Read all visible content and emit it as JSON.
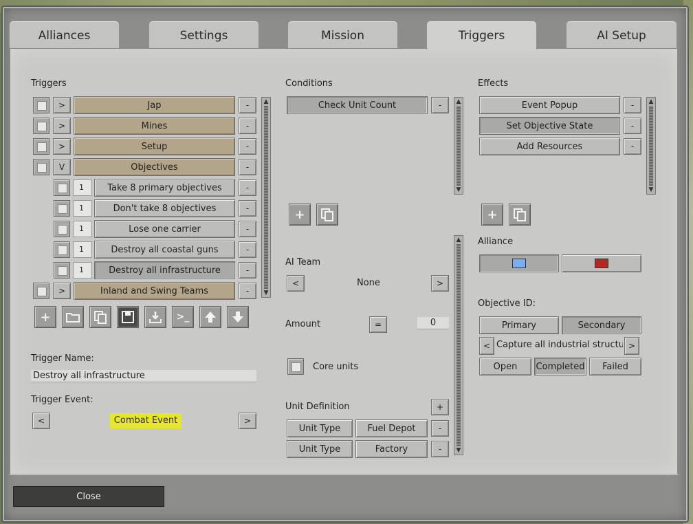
{
  "tabs": [
    {
      "label": "Alliances"
    },
    {
      "label": "Settings"
    },
    {
      "label": "Mission"
    },
    {
      "label": "Triggers"
    },
    {
      "label": "AI Setup"
    }
  ],
  "triggers": {
    "heading": "Triggers",
    "items": [
      {
        "expander": ">",
        "label": "Jap",
        "num": ""
      },
      {
        "expander": ">",
        "label": "Mines",
        "num": ""
      },
      {
        "expander": ">",
        "label": "Setup",
        "num": ""
      },
      {
        "expander": "V",
        "label": "Objectives",
        "num": ""
      },
      {
        "expander": "",
        "label": "Take 8 primary objectives",
        "num": "1"
      },
      {
        "expander": "",
        "label": "Don't take 8 objectives",
        "num": "1"
      },
      {
        "expander": "",
        "label": "Lose one carrier",
        "num": "1"
      },
      {
        "expander": "",
        "label": "Destroy all coastal guns",
        "num": "1"
      },
      {
        "expander": "",
        "label": "Destroy all infrastructure",
        "num": "1"
      },
      {
        "expander": ">",
        "label": "Inland and Swing Teams",
        "num": ""
      }
    ],
    "remove_label": "-",
    "toolbar": [
      "add-icon",
      "folder-icon",
      "copy-icon",
      "save-icon",
      "import-icon",
      "console-icon",
      "arrow-up-icon",
      "arrow-down-icon"
    ],
    "name_label": "Trigger Name:",
    "name_value": "Destroy all infrastructure",
    "event_label": "Trigger Event:",
    "event_value": "Combat Event",
    "prev": "<",
    "next": ">"
  },
  "conditions": {
    "heading": "Conditions",
    "items": [
      {
        "label": "Check Unit Count"
      }
    ],
    "remove_label": "-",
    "ai_team_label": "AI Team",
    "ai_team_value": "None",
    "prev": "<",
    "next": ">",
    "amount_label": "Amount",
    "amount_op": "=",
    "amount_value": "0",
    "core_units_label": "Core units",
    "unit_def_label": "Unit Definition",
    "add_label": "+",
    "unit_defs": [
      {
        "type": "Unit Type",
        "value": "Fuel Depot"
      },
      {
        "type": "Unit Type",
        "value": "Factory"
      }
    ]
  },
  "effects": {
    "heading": "Effects",
    "items": [
      {
        "label": "Event Popup"
      },
      {
        "label": "Set Objective State"
      },
      {
        "label": "Add Resources"
      }
    ],
    "remove_label": "-",
    "alliance_label": "Alliance",
    "alliance_colors": [
      "#7aaef0",
      "#b02a22"
    ],
    "objective_label": "Objective ID:",
    "primary": "Primary",
    "secondary": "Secondary",
    "objective_value": "Capture all industrial structure",
    "prev": "<",
    "next": ">",
    "open": "Open",
    "completed": "Completed",
    "failed": "Failed"
  },
  "footer": {
    "close": "Close"
  },
  "colors": {
    "highlight": "#e6e62a",
    "tan": "#b3a58a"
  }
}
